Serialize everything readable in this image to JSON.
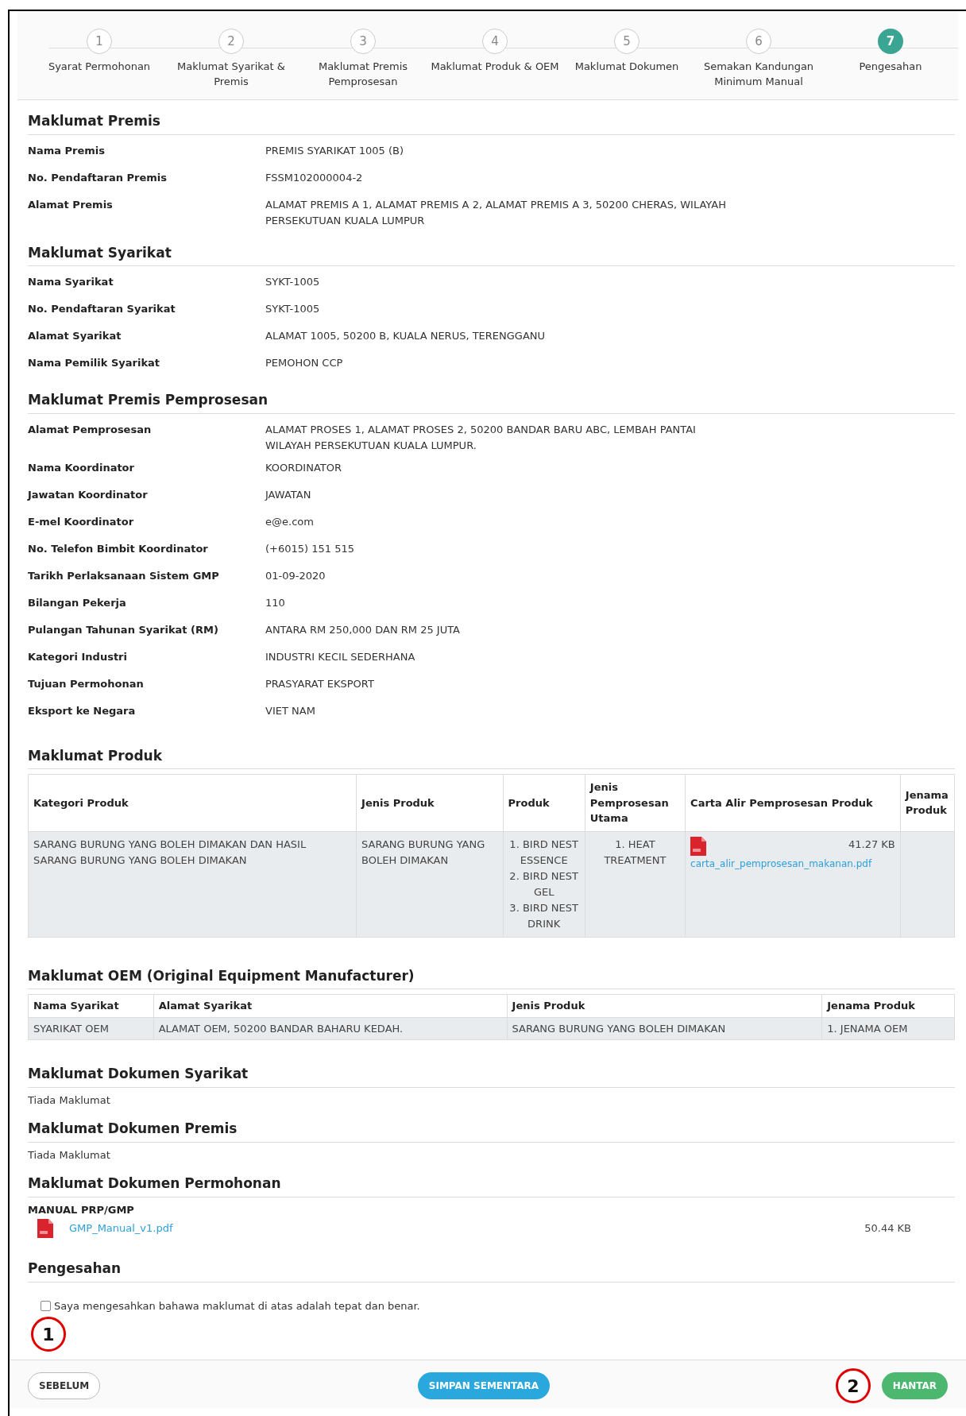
{
  "steps": [
    {
      "number": "1",
      "label": "Syarat Permohonan",
      "selected": false
    },
    {
      "number": "2",
      "label": "Maklumat Syarikat & Premis",
      "selected": false
    },
    {
      "number": "3",
      "label": "Maklumat Premis Pemprosesan",
      "selected": false
    },
    {
      "number": "4",
      "label": "Maklumat Produk & OEM",
      "selected": false
    },
    {
      "number": "5",
      "label": "Maklumat Dokumen",
      "selected": false
    },
    {
      "number": "6",
      "label": "Semakan Kandungan Minimum Manual",
      "selected": false
    },
    {
      "number": "7",
      "label": "Pengesahan",
      "selected": true
    }
  ],
  "sections": [
    {
      "kind": "fields",
      "title": "Maklumat Premis",
      "fields": [
        {
          "label": "Nama Premis",
          "value": "PREMIS SYARIKAT 1005 (B)"
        },
        {
          "label": "No. Pendaftaran Premis",
          "value": "FSSM102000004-2"
        },
        {
          "label": "Alamat Premis",
          "value": "ALAMAT PREMIS A 1, ALAMAT PREMIS A 2, ALAMAT PREMIS A 3, 50200 CHERAS, WILAYAH PERSEKUTUAN KUALA LUMPUR"
        }
      ]
    },
    {
      "kind": "fields",
      "title": "Maklumat Syarikat",
      "fields": [
        {
          "label": "Nama Syarikat",
          "value": "SYKT-1005"
        },
        {
          "label": "No. Pendaftaran Syarikat",
          "value": "SYKT-1005"
        },
        {
          "label": "Alamat Syarikat",
          "value": "ALAMAT 1005, 50200 B, KUALA NERUS, TERENGGANU"
        },
        {
          "label": "Nama Pemilik Syarikat",
          "value": "PEMOHON CCP"
        }
      ]
    },
    {
      "kind": "fields",
      "title": "Maklumat Premis Pemprosesan",
      "fields": [
        {
          "label": "Alamat Pemprosesan",
          "value": "ALAMAT PROSES 1, ALAMAT PROSES 2, 50200 BANDAR BARU ABC, LEMBAH PANTAI WILAYAH PERSEKUTUAN KUALA LUMPUR."
        },
        {
          "label": "Nama Koordinator",
          "value": "KOORDINATOR"
        },
        {
          "label": "Jawatan Koordinator",
          "value": "JAWATAN"
        },
        {
          "label": "E-mel Koordinator",
          "value": "e@e.com"
        },
        {
          "label": "No. Telefon Bimbit Koordinator",
          "value": "(+6015) 151 515"
        },
        {
          "label": "Tarikh Perlaksanaan Sistem GMP",
          "value": "01-09-2020"
        },
        {
          "label": "Bilangan Pekerja",
          "value": "110"
        },
        {
          "label": "Pulangan Tahunan Syarikat (RM)",
          "value": "ANTARA RM 250,000 DAN RM 25 JUTA"
        },
        {
          "label": "Kategori Industri",
          "value": "INDUSTRI KECIL SEDERHANA"
        },
        {
          "label": "Tujuan Permohonan",
          "value": "PRASYARAT EKSPORT"
        },
        {
          "label": "Eksport ke Negara",
          "value": "VIET NAM"
        }
      ]
    },
    {
      "kind": "product_table",
      "title": "Maklumat Produk",
      "columns": [
        "Kategori Produk",
        "Jenis Produk",
        "Produk",
        "Jenis Pemprosesan Utama",
        "Carta Alir Pemprosesan Produk",
        "Jenama Produk"
      ],
      "rows": [
        {
          "kategori": "SARANG BURUNG YANG BOLEH DIMAKAN DAN HASIL SARANG BURUNG YANG BOLEH DIMAKAN",
          "jenis": "SARANG BURUNG YANG BOLEH DIMAKAN",
          "produk": [
            "1. BIRD NEST ESSENCE",
            "2. BIRD NEST GEL",
            "3. BIRD NEST DRINK"
          ],
          "pemprosesan": [
            "1. HEAT TREATMENT"
          ],
          "file_size": "41.27 KB",
          "file_name": "carta_alir_pemprosesan_makanan.pdf"
        }
      ]
    },
    {
      "kind": "table",
      "title": "Maklumat OEM (Original Equipment Manufacturer)",
      "columns": [
        "Nama Syarikat",
        "Alamat Syarikat",
        "Jenis Produk",
        "Jenama Produk"
      ],
      "rows": [
        [
          "SYARIKAT OEM",
          "ALAMAT OEM, 50200 BANDAR BAHARU KEDAH.",
          "SARANG BURUNG YANG BOLEH DIMAKAN",
          "1. JENAMA OEM"
        ]
      ]
    },
    {
      "kind": "text",
      "title": "Maklumat Dokumen Syarikat",
      "text": "Tiada Maklumat"
    },
    {
      "kind": "text",
      "title": "Maklumat Dokumen Premis",
      "text": "Tiada Maklumat"
    },
    {
      "kind": "documents",
      "title": "Maklumat Dokumen Permohonan",
      "groups": [
        {
          "name": "MANUAL PRP/GMP",
          "files": [
            {
              "name": "GMP_Manual_v1.pdf",
              "size": "50.44 KB"
            }
          ]
        }
      ]
    }
  ],
  "confirmation": {
    "title": "Pengesahan",
    "label": "Saya mengesahkan bahawa maklumat di atas adalah tepat dan benar.",
    "checked": false
  },
  "callouts": [
    "1",
    "2"
  ],
  "buttons": {
    "back": "SEBELUM",
    "save": "SIMPAN SEMENTARA",
    "submit": "HANTAR"
  }
}
